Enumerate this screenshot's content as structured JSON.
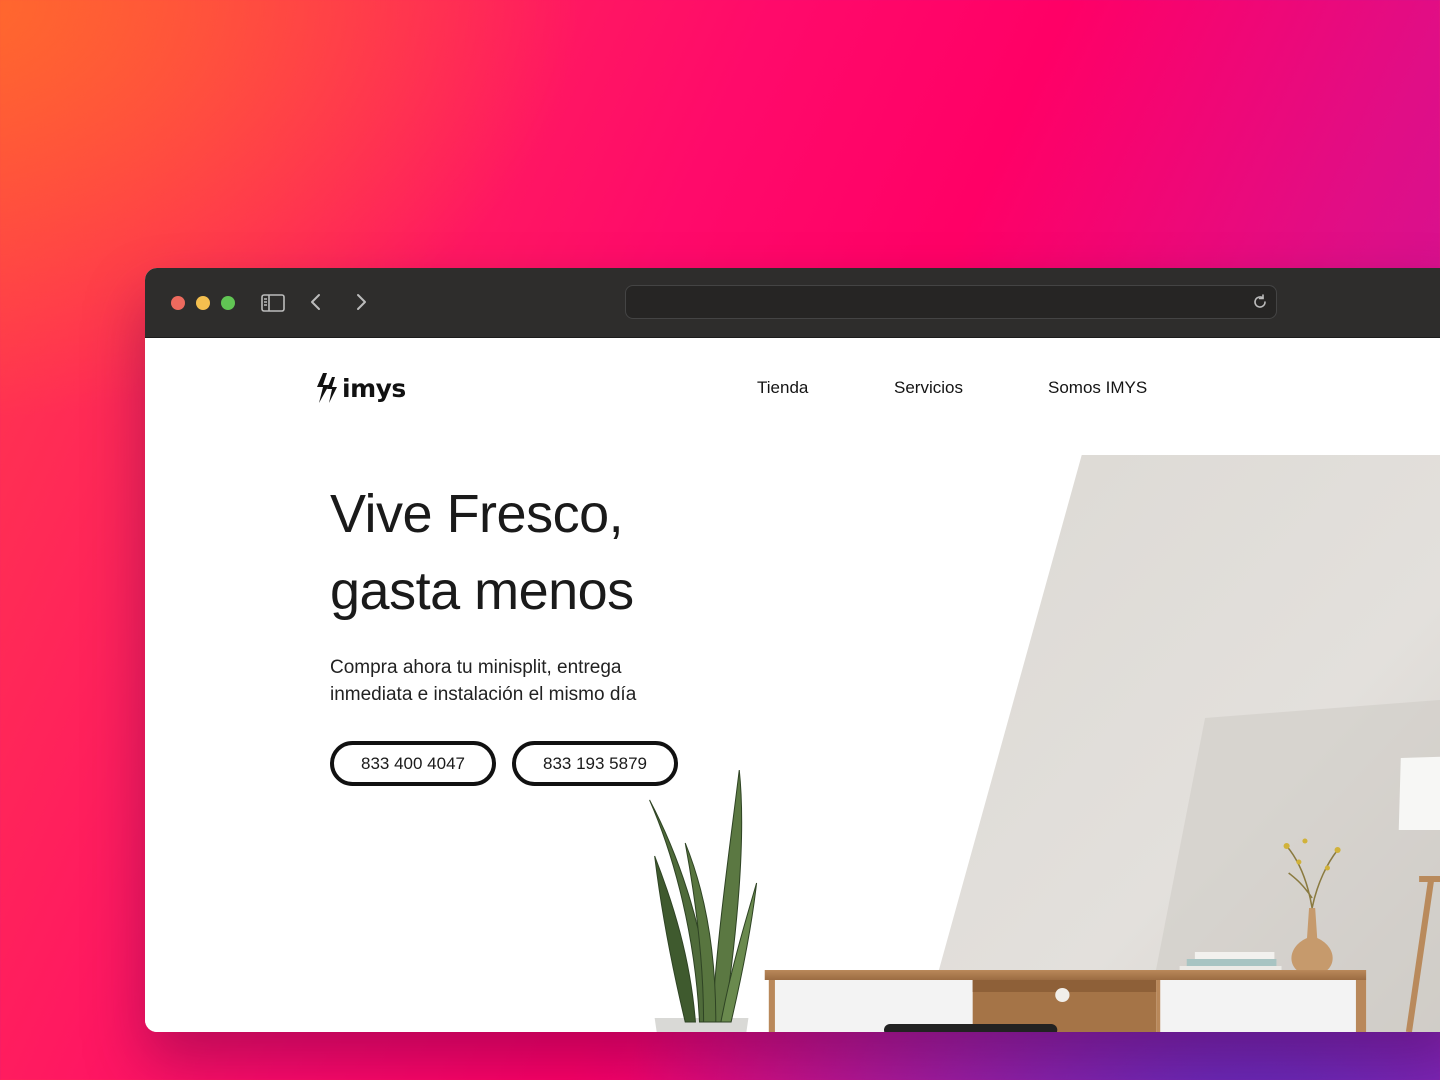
{
  "browser": {
    "url": ""
  },
  "site": {
    "logo_text": "imys",
    "nav": [
      {
        "label": "Tienda"
      },
      {
        "label": "Servicios"
      },
      {
        "label": "Somos IMYS"
      }
    ]
  },
  "hero": {
    "title_line1": "Vive Fresco,",
    "title_line2": "gasta menos",
    "subtitle_line1": "Compra ahora tu minisplit, entrega",
    "subtitle_line2": "inmediata e instalación el mismo día",
    "phones": [
      {
        "label": "833 400 4047"
      },
      {
        "label": "833 193 5879"
      }
    ]
  },
  "colors": {
    "accent_text": "#111111",
    "titlebar": "#2e2d2c"
  },
  "icons": [
    "sidebar-icon",
    "back-icon",
    "forward-icon",
    "reload-icon",
    "bolt-logo-icon"
  ]
}
